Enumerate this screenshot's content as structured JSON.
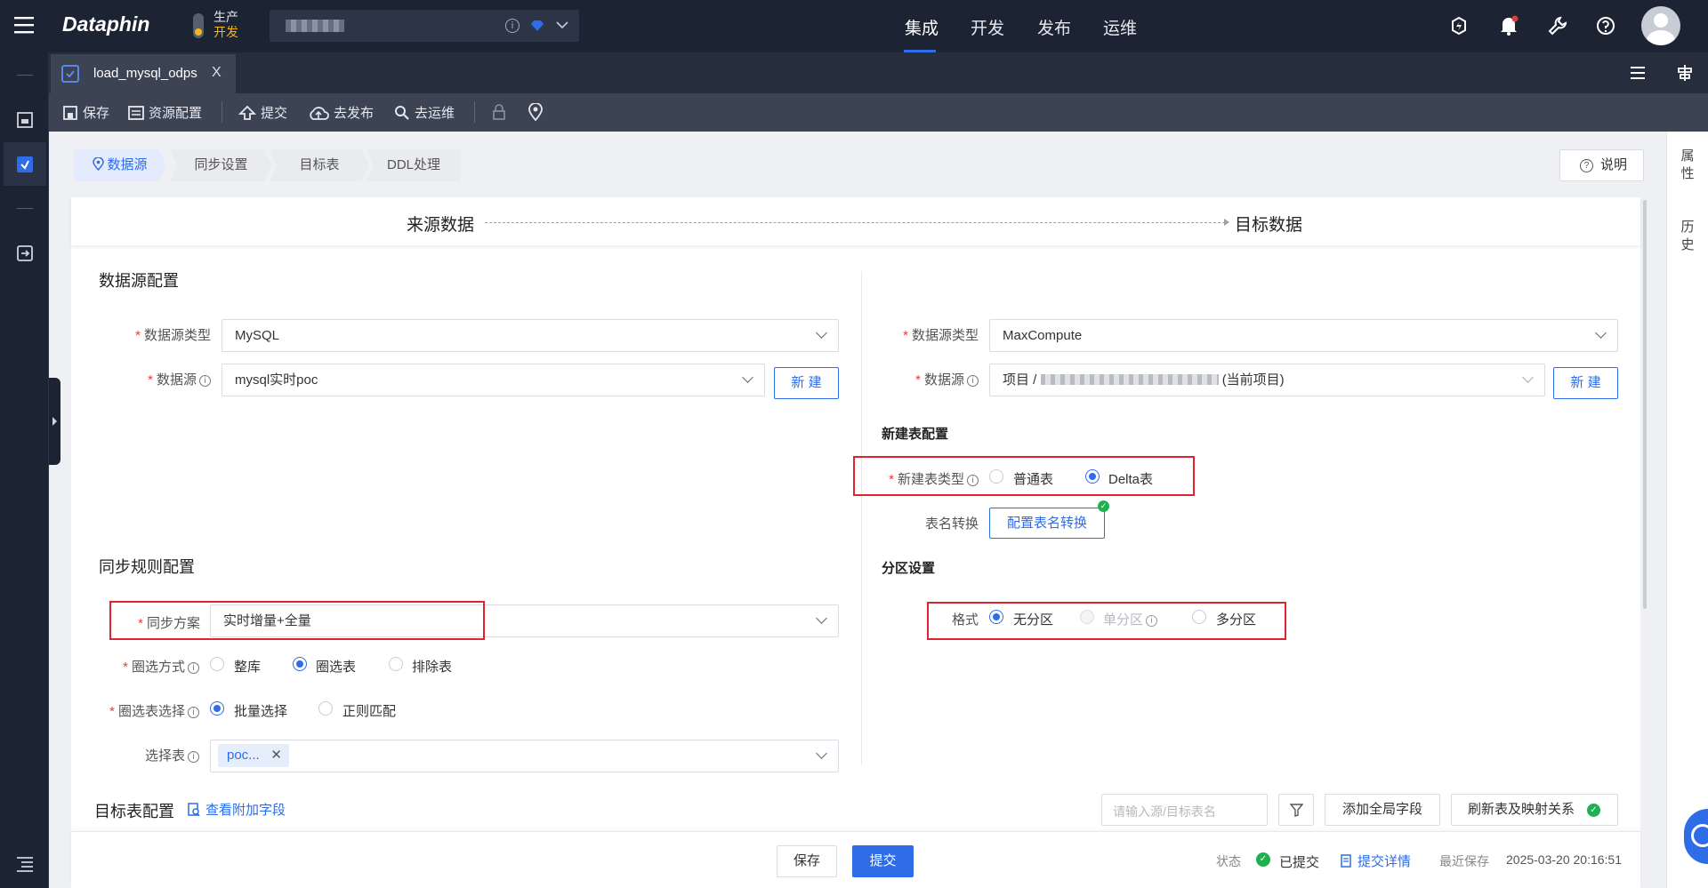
{
  "topnav": {
    "logo": "Dataphin",
    "env_prod": "生产",
    "env_dev": "开发",
    "menu": [
      "集成",
      "开发",
      "发布",
      "运维"
    ],
    "active_menu": 0
  },
  "tab": {
    "label": "load_mysql_odps",
    "close": "X"
  },
  "toolbar": {
    "save": "保存",
    "resource": "资源配置",
    "submit": "提交",
    "publish": "去发布",
    "ops": "去运维"
  },
  "steps": [
    "数据源",
    "同步设置",
    "目标表",
    "DDL处理"
  ],
  "help_button": "说明",
  "flow": {
    "source": "来源数据",
    "target": "目标数据"
  },
  "source": {
    "section_title": "数据源配置",
    "type_label": "数据源类型",
    "type_value": "MySQL",
    "ds_label": "数据源",
    "ds_value": "mysql实时poc",
    "new_button": "新 建"
  },
  "sync_rules": {
    "section_title": "同步规则配置",
    "plan_label": "同步方案",
    "plan_value": "实时增量+全量",
    "circle_label": "圈选方式",
    "circle_options": [
      "整库",
      "圈选表",
      "排除表"
    ],
    "circle_selected": 1,
    "table_select_label": "圈选表选择",
    "table_select_options": [
      "批量选择",
      "正则匹配"
    ],
    "table_select_selected": 0,
    "choose_table_label": "选择表",
    "chosen_tag": "poc..."
  },
  "target": {
    "type_label": "数据源类型",
    "type_value": "MaxCompute",
    "ds_label": "数据源",
    "ds_prefix": "项目 /",
    "ds_suffix": "(当前项目)",
    "new_button": "新 建",
    "new_table_title": "新建表配置",
    "new_table_type_label": "新建表类型",
    "new_table_options": [
      "普通表",
      "Delta表"
    ],
    "new_table_selected": 1,
    "rename_label": "表名转换",
    "rename_button": "配置表名转换",
    "partition_title": "分区设置",
    "format_label": "格式",
    "partition_options": [
      "无分区",
      "单分区",
      "多分区"
    ],
    "partition_selected": 0
  },
  "target_config": {
    "title": "目标表配置",
    "view_extra": "查看附加字段",
    "search_placeholder": "请输入源/目标表名",
    "add_global": "添加全局字段",
    "refresh": "刷新表及映射关系"
  },
  "footer": {
    "save": "保存",
    "submit": "提交",
    "status_label": "状态",
    "status_value": "已提交",
    "submit_detail": "提交详情",
    "last_save_label": "最近保存",
    "last_save_time": "2025-03-20 20:16:51"
  },
  "right_rail": {
    "props": "属性",
    "history": "历史"
  },
  "colors": {
    "accent": "#2f6ce8",
    "nav_bg": "#1c2333",
    "red_box": "#e0242f",
    "success": "#1fb14f"
  }
}
